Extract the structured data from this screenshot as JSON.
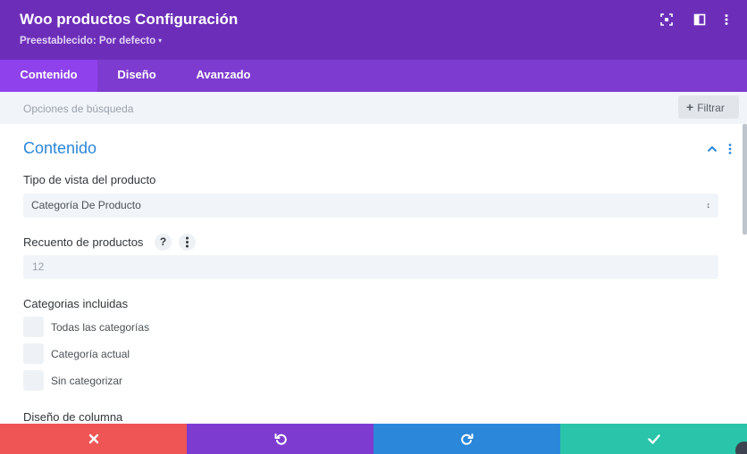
{
  "header": {
    "title": "Woo productos Configuración",
    "preset_label": "Preestablecido: Por defecto",
    "icons": [
      "expand-icon",
      "sidebar-layout-icon",
      "more-vertical-icon"
    ]
  },
  "tabs": [
    {
      "label": "Contenido",
      "active": true
    },
    {
      "label": "Diseño",
      "active": false
    },
    {
      "label": "Avanzado",
      "active": false
    }
  ],
  "search": {
    "placeholder": "Opciones de búsqueda",
    "filter_label": "Filtrar"
  },
  "section": {
    "title": "Contenido",
    "expanded": true
  },
  "fields": {
    "view_type": {
      "label": "Tipo de vista del producto",
      "value": "Categoría De Producto"
    },
    "product_count": {
      "label": "Recuento de productos",
      "help": "?",
      "placeholder": "12"
    },
    "categories": {
      "label": "Categorias incluidas",
      "options": [
        {
          "label": "Todas las categorías",
          "checked": false
        },
        {
          "label": "Categoría actual",
          "checked": false
        },
        {
          "label": "Sin categorizar",
          "checked": false
        }
      ]
    },
    "column_layout": {
      "label": "Diseño de columna"
    }
  },
  "footer": {
    "buttons": [
      "discard",
      "undo",
      "redo",
      "save"
    ],
    "colors": {
      "discard": "#ef5555",
      "undo": "#7e3bd0",
      "redo": "#2b87da",
      "save": "#29c4a9"
    }
  },
  "colors": {
    "header_bg": "#6c2eb9",
    "tabs_bg": "#7e3bd0",
    "active_tab_bg": "#8f42ec",
    "accent": "#2b87da"
  }
}
